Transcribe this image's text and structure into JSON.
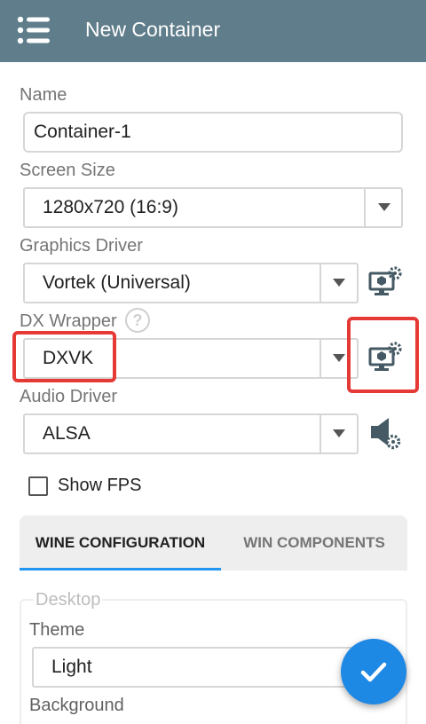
{
  "appbar": {
    "title": "New Container",
    "menu_icon": "menu-icon"
  },
  "form": {
    "name_label": "Name",
    "name_value": "Container-1",
    "screen_size_label": "Screen Size",
    "screen_size_value": "1280x720 (16:9)",
    "graphics_driver_label": "Graphics Driver",
    "graphics_driver_value": "Vortek (Universal)",
    "dx_wrapper_label": "DX Wrapper",
    "dx_wrapper_help": "?",
    "dx_wrapper_value": "DXVK",
    "audio_driver_label": "Audio Driver",
    "audio_driver_value": "ALSA",
    "show_fps_label": "Show FPS",
    "show_fps_checked": false
  },
  "tabs": [
    {
      "label": "WINE CONFIGURATION",
      "active": true
    },
    {
      "label": "WIN COMPONENTS",
      "active": false
    }
  ],
  "wine_config": {
    "group_title": "Desktop",
    "theme_label": "Theme",
    "theme_value": "Light",
    "background_label": "Background"
  },
  "colors": {
    "appbar": "#607d8b",
    "accent": "#2196f3",
    "fab": "#1e88e5",
    "highlight": "#e53935",
    "icon_gray": "#455a64"
  },
  "icons": [
    "menu-icon",
    "monitor-settings-icon",
    "speaker-settings-icon",
    "help-icon",
    "check-icon",
    "chevron-down-icon"
  ]
}
